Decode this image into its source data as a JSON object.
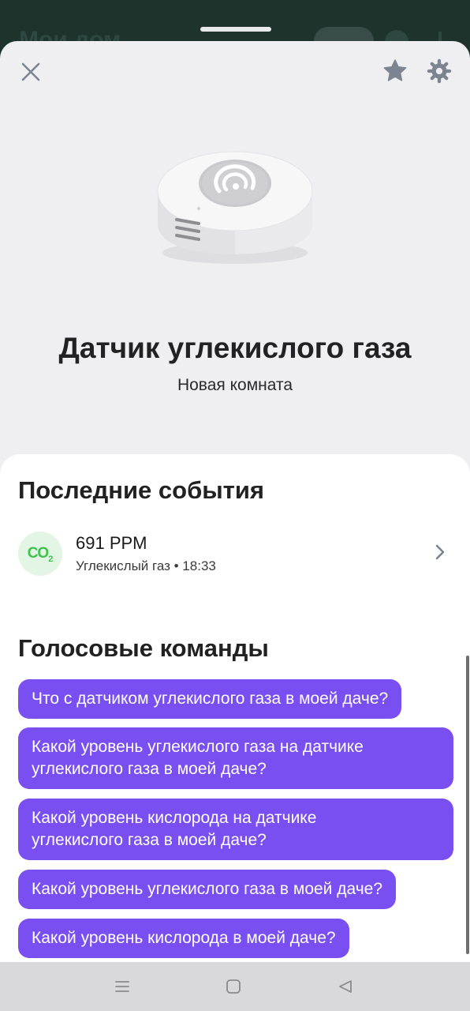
{
  "background_app": {
    "title": "Мои дом"
  },
  "header": {
    "close_icon": "close-icon",
    "favorite_icon": "star-icon",
    "settings_icon": "gear-icon"
  },
  "device": {
    "image_icon": "co2-sensor-device-image",
    "name": "Датчик углекислого газа",
    "room": "Новая комната"
  },
  "events": {
    "title": "Последние события",
    "items": [
      {
        "icon": "co2-icon",
        "icon_text_main": "CO",
        "icon_text_sub": "2",
        "value": "691 PPM",
        "meta": "Углекислый газ • 18:33"
      }
    ]
  },
  "voice_commands": {
    "title": "Голосовые команды",
    "items": [
      "Что с датчиком углекислого газа в моей даче?",
      "Какой уровень углекислого газа на датчике\nуглекислого газа в моей даче?",
      "Какой уровень кислорода на датчике\nуглекислого газа в моей даче?",
      "Какой уровень углекислого газа в моей даче?",
      "Какой уровень кислорода в моей даче?"
    ]
  },
  "colors": {
    "accent_purple": "#7a4ff2",
    "co2_green": "#3ec24c",
    "icon_gray": "#7d8491",
    "sheet_bg": "#efeff2"
  }
}
